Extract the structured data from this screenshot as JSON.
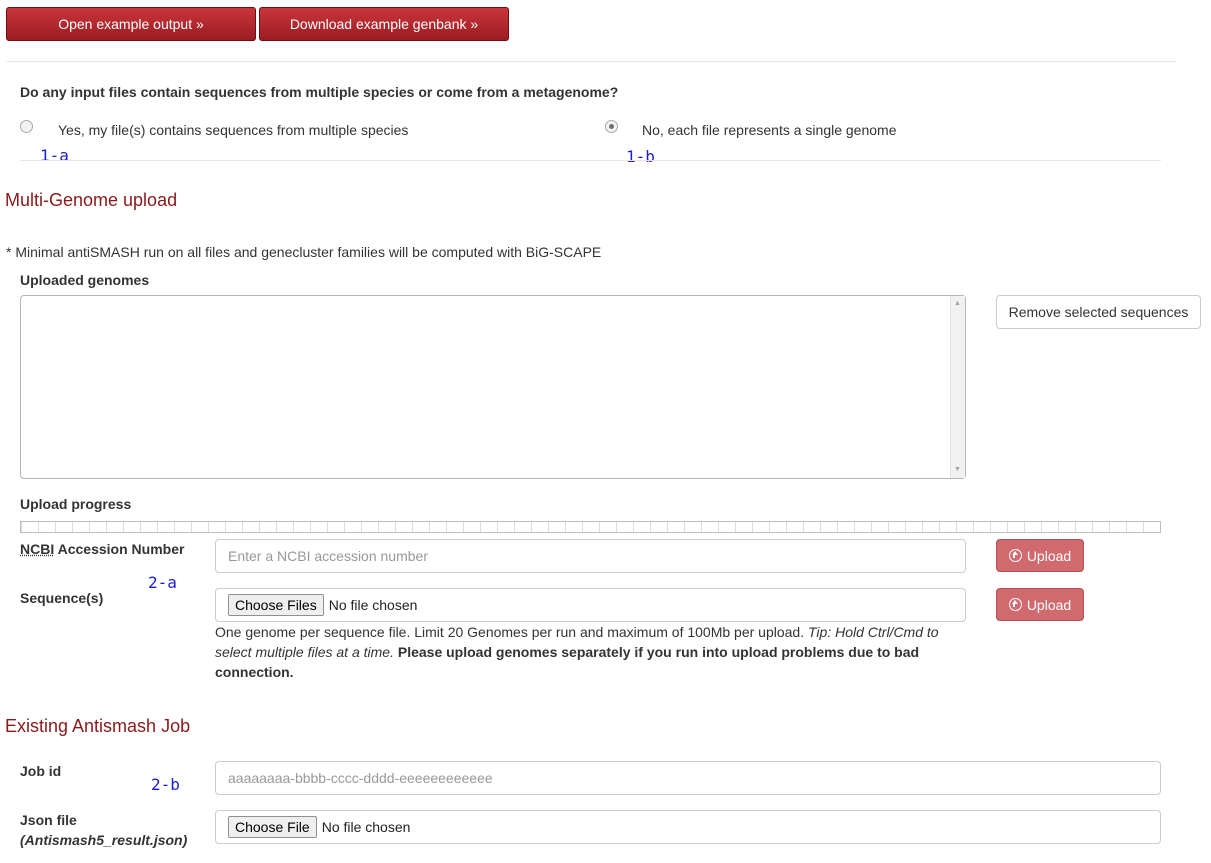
{
  "top_buttons": {
    "open_example": "Open example output »",
    "download_example": "Download example genbank »"
  },
  "metagenome_question": {
    "question": "Do any input files contain sequences from multiple species or come from a metagenome?",
    "option_yes": "Yes, my file(s) contains sequences from multiple species",
    "option_no": "No, each file represents a single genome",
    "selected": "no"
  },
  "annotations": {
    "a1": "1-a",
    "b1": "1-b",
    "a2": "2-a",
    "b2": "2-b"
  },
  "multi_genome": {
    "title": "Multi-Genome upload",
    "note": "* Minimal antiSMASH run on all files and genecluster families will be computed with BiG-SCAPE",
    "uploaded_label": "Uploaded genomes",
    "remove_button": "Remove selected sequences",
    "progress_label": "Upload progress",
    "progress_value": 0,
    "ncbi_abbr": "NCBI",
    "ncbi_label_rest": " Accession Number",
    "ncbi_placeholder": "Enter a NCBI accession number",
    "upload_button": "Upload",
    "sequences_label": "Sequence(s)",
    "choose_files": "Choose Files",
    "no_file": "No file chosen",
    "help_plain": "One genome per sequence file. Limit 20 Genomes per run and maximum of 100Mb per upload. ",
    "help_tip": "Tip: Hold Ctrl/Cmd to select multiple files at a time.",
    "help_bold": " Please upload genomes separately if you run into upload problems due to bad connection."
  },
  "existing_job": {
    "title": "Existing Antismash Job",
    "job_label": "Job id",
    "job_placeholder": "aaaaaaaa-bbbb-cccc-dddd-eeeeeeeeeeee",
    "json_label": "Json file",
    "json_sub": "(Antismash5_result.json)",
    "choose_file": "Choose File",
    "no_file": "No file chosen"
  },
  "colors": {
    "brand_red": "#9b1c22",
    "section_title": "#8b1a1a",
    "upload_button": "#d06a6e",
    "annotation": "#1d1dcc"
  }
}
